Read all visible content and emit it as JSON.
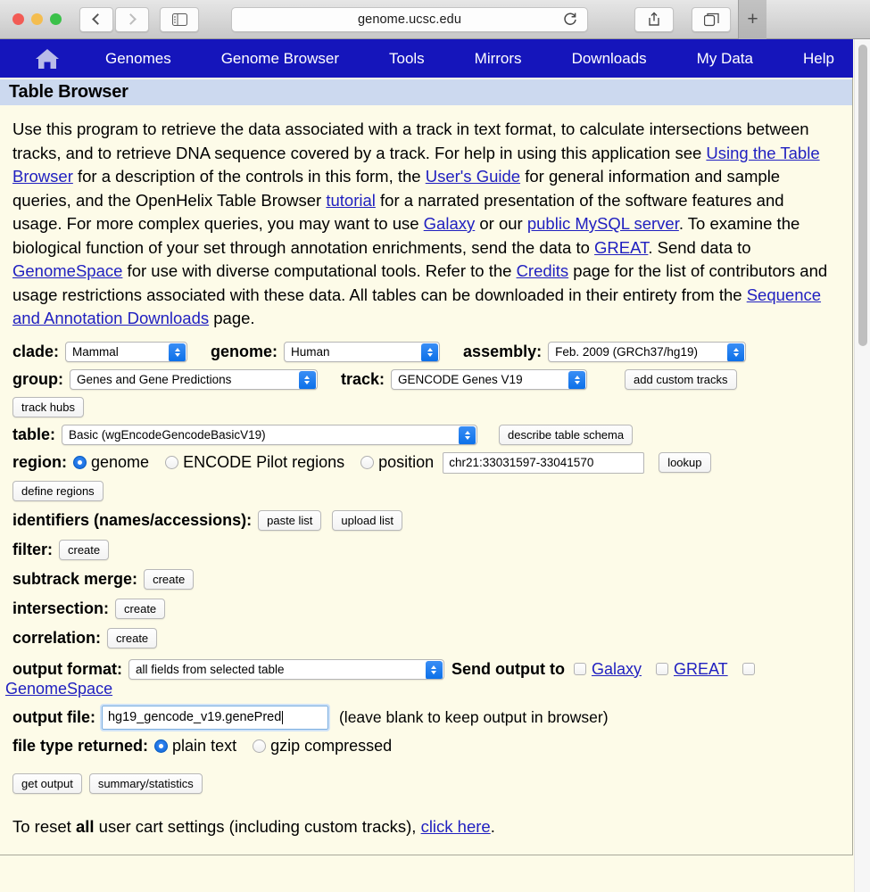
{
  "browser": {
    "url": "genome.ucsc.edu",
    "icons": {
      "back": "back-chevron-icon",
      "forward": "forward-chevron-icon",
      "sidebar": "sidebar-toggle-icon",
      "reload": "reload-icon",
      "share": "share-icon",
      "tabs": "show-tabs-icon",
      "new_tab": "+"
    }
  },
  "nav": {
    "home_icon": "home-icon",
    "items": [
      {
        "label": "Genomes"
      },
      {
        "label": "Genome Browser"
      },
      {
        "label": "Tools"
      },
      {
        "label": "Mirrors"
      },
      {
        "label": "Downloads"
      },
      {
        "label": "My Data"
      },
      {
        "label": "Help"
      }
    ]
  },
  "page": {
    "title": "Table Browser",
    "intro": {
      "t1": "Use this program to retrieve the data associated with a track in text format, to calculate intersections between tracks, and to retrieve DNA sequence covered by a track. For help in using this application see ",
      "l1": "Using the Table Browser",
      "t2": " for a description of the controls in this form, the ",
      "l2": "User's Guide",
      "t3": " for general information and sample queries, and the OpenHelix Table Browser ",
      "l3": "tutorial",
      "t4": " for a narrated presentation of the software features and usage. For more complex queries, you may want to use ",
      "l4": "Galaxy",
      "t5": " or our ",
      "l5": "public MySQL server",
      "t6": ". To examine the biological function of your set through annotation enrichments, send the data to ",
      "l6": "GREAT",
      "t7": ". Send data to ",
      "l7": "GenomeSpace",
      "t8": " for use with diverse computational tools. Refer to the ",
      "l8": "Credits",
      "t9": " page for the list of contributors and usage restrictions associated with these data. All tables can be downloaded in their entirety from the ",
      "l9": "Sequence and Annotation Downloads",
      "t10": " page."
    }
  },
  "form": {
    "clade": {
      "label": "clade:",
      "value": "Mammal"
    },
    "genome": {
      "label": "genome:",
      "value": "Human"
    },
    "assembly": {
      "label": "assembly:",
      "value": "Feb. 2009 (GRCh37/hg19)"
    },
    "group": {
      "label": "group:",
      "value": "Genes and Gene Predictions"
    },
    "track": {
      "label": "track:",
      "value": "GENCODE Genes V19"
    },
    "add_custom_tracks": "add custom tracks",
    "track_hubs": "track hubs",
    "table": {
      "label": "table:",
      "value": "Basic (wgEncodeGencodeBasicV19)"
    },
    "describe_table_schema": "describe table schema",
    "region": {
      "label": "region:",
      "options": [
        {
          "label": "genome",
          "selected": true
        },
        {
          "label": "ENCODE Pilot regions",
          "selected": false
        },
        {
          "label": "position",
          "selected": false
        }
      ],
      "position_value": "chr21:33031597-33041570",
      "lookup": "lookup"
    },
    "define_regions": "define regions",
    "identifiers": {
      "label": "identifiers (names/accessions):",
      "paste": "paste list",
      "upload": "upload list"
    },
    "filter": {
      "label": "filter:",
      "button": "create"
    },
    "subtrack_merge": {
      "label": "subtrack merge:",
      "button": "create"
    },
    "intersection": {
      "label": "intersection:",
      "button": "create"
    },
    "correlation": {
      "label": "correlation:",
      "button": "create"
    },
    "output_format": {
      "label": "output format:",
      "value": "all fields from selected table"
    },
    "send_output_to": {
      "label": "Send output to",
      "targets": [
        {
          "label": "Galaxy",
          "checked": false
        },
        {
          "label": "GREAT",
          "checked": false
        },
        {
          "label": "GenomeSpace",
          "checked": false
        }
      ]
    },
    "output_file": {
      "label": "output file:",
      "value": "hg19_gencode_v19.genePred",
      "hint": "(leave blank to keep output in browser)"
    },
    "file_type_returned": {
      "label": "file type returned:",
      "options": [
        {
          "label": "plain text",
          "selected": true
        },
        {
          "label": "gzip compressed",
          "selected": false
        }
      ]
    },
    "get_output": "get output",
    "summary_statistics": "summary/statistics"
  },
  "footer": {
    "reset_prefix": "To reset ",
    "reset_bold": "all",
    "reset_mid": " user cart settings (including custom tracks), ",
    "reset_link": "click here",
    "reset_suffix": "."
  },
  "colors": {
    "nav_blue": "#1515bb",
    "page_bg": "#fdfbe8",
    "title_bar": "#ccd9ef",
    "link": "#2020c0",
    "accent_blue": "#0a6fe8"
  }
}
